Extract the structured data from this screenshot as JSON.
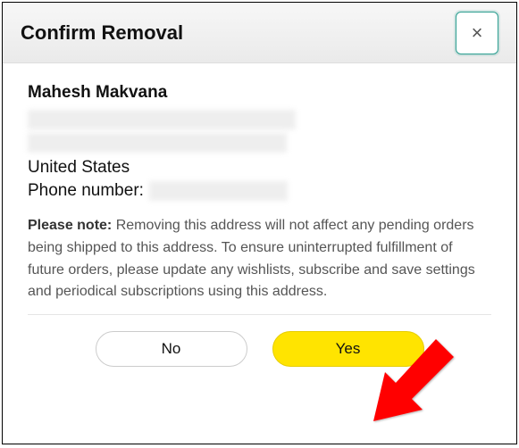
{
  "header": {
    "title": "Confirm Removal",
    "close_icon": "×"
  },
  "address": {
    "name": "Mahesh Makvana",
    "country": "United States",
    "phone_label": "Phone number:"
  },
  "note": {
    "label": "Please note:",
    "text": " Removing this address will not affect any pending orders being shipped to this address. To ensure uninterrupted fulfillment of future orders, please update any wishlists, subscribe and save settings and periodical subscriptions using this address."
  },
  "buttons": {
    "no": "No",
    "yes": "Yes"
  }
}
